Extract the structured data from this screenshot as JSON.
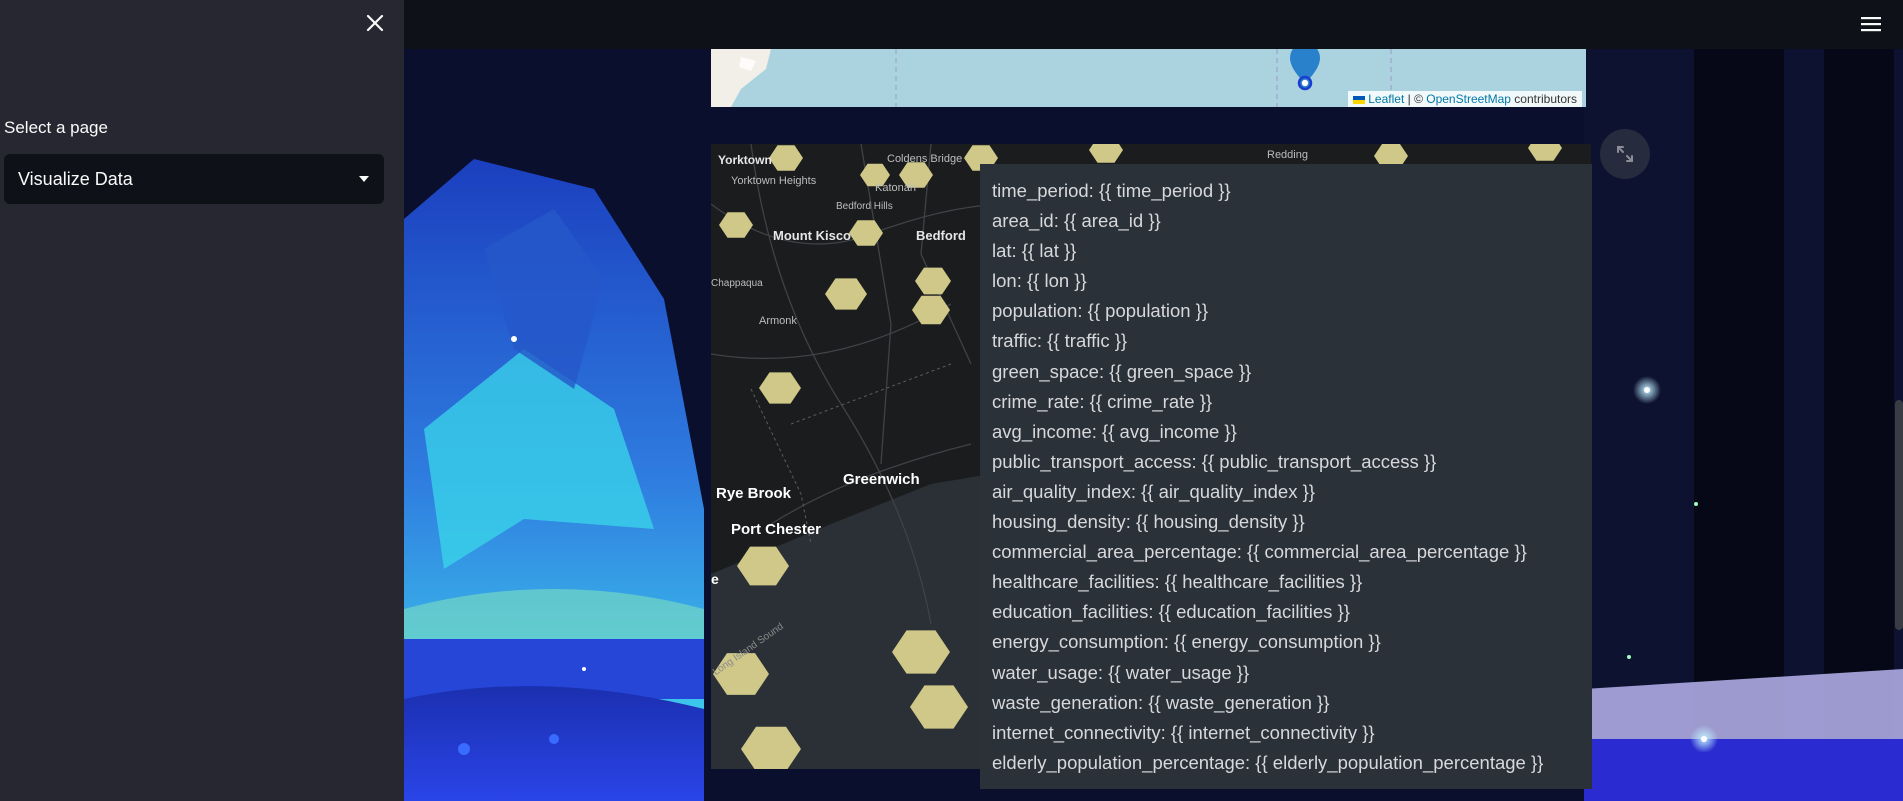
{
  "sidebar": {
    "close_icon": "close-icon",
    "select_label": "Select a page",
    "select_value": "Visualize Data"
  },
  "header": {
    "menu_icon": "hamburger-menu-icon"
  },
  "top_map": {
    "attribution": {
      "leaflet": "Leaflet",
      "separator": " | © ",
      "osm": "OpenStreetMap",
      "suffix": " contributors"
    },
    "marker_icon": "map-pin-icon",
    "marker_color": "#2a81cb"
  },
  "hex_map": {
    "hex_color": "#cfc889",
    "place_labels": [
      "Yorktown",
      "Coldens Bridge",
      "Redding",
      "Yorktown Heights",
      "Katonah",
      "Bedford Hills",
      "Mount Kisco",
      "Bedford",
      "Chappaqua",
      "Armonk",
      "Greenwich",
      "Rye Brook",
      "Port Chester",
      "e",
      "Long Island Sound"
    ],
    "fullscreen_icon": "expand-icon"
  },
  "tooltip": {
    "rows": [
      "time_period: {{ time_period }}",
      "area_id: {{ area_id }}",
      "lat: {{ lat }}",
      "lon: {{ lon }}",
      "population: {{ population }}",
      "traffic: {{ traffic }}",
      "green_space: {{ green_space }}",
      "crime_rate: {{ crime_rate }}",
      "avg_income: {{ avg_income }}",
      "public_transport_access: {{ public_transport_access }}",
      "air_quality_index: {{ air_quality_index }}",
      "housing_density: {{ housing_density }}",
      "commercial_area_percentage: {{ commercial_area_percentage }}",
      "healthcare_facilities: {{ healthcare_facilities }}",
      "education_facilities: {{ education_facilities }}",
      "energy_consumption: {{ energy_consumption }}",
      "water_usage: {{ water_usage }}",
      "waste_generation: {{ waste_generation }}",
      "internet_connectivity: {{ internet_connectivity }}",
      "elderly_population_percentage: {{ elderly_population_percentage }}"
    ]
  },
  "colors": {
    "sidebar_bg": "#262730",
    "app_bg": "#0e1117",
    "tooltip_bg": "#2b3138"
  }
}
